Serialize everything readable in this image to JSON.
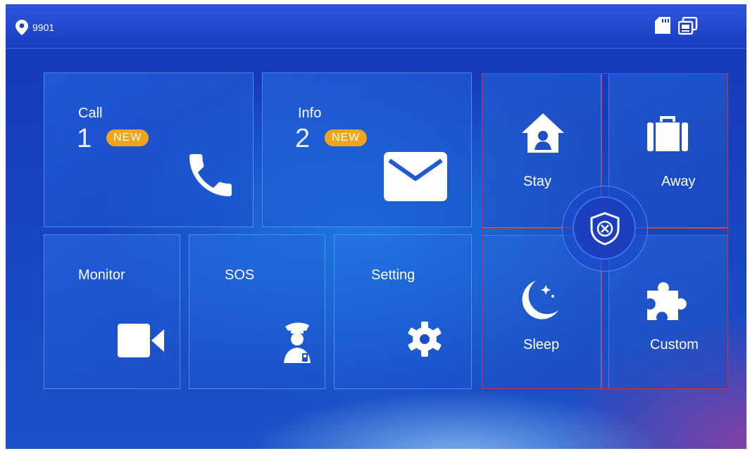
{
  "status_bar": {
    "location_code": "9901",
    "location_icon": "location-pin-icon",
    "right_icons": [
      "sd-card-icon",
      "screens-icon"
    ]
  },
  "tiles": {
    "call": {
      "label": "Call",
      "count": "1",
      "badge": "NEW",
      "icon": "phone-icon"
    },
    "info": {
      "label": "Info",
      "count": "2",
      "badge": "NEW",
      "icon": "envelope-icon"
    },
    "monitor": {
      "label": "Monitor",
      "icon": "video-camera-icon"
    },
    "sos": {
      "label": "SOS",
      "icon": "guard-icon"
    },
    "setting": {
      "label": "Setting",
      "icon": "gear-icon"
    }
  },
  "security": {
    "stay": {
      "label": "Stay",
      "icon": "home-person-icon"
    },
    "away": {
      "label": "Away",
      "icon": "suitcase-icon"
    },
    "sleep": {
      "label": "Sleep",
      "icon": "moon-icon"
    },
    "custom": {
      "label": "Custom",
      "icon": "puzzle-icon"
    },
    "center_icon": "shield-disarm-icon"
  },
  "colors": {
    "accent": "#f0a41a",
    "highlight_border": "#d0303a",
    "background": "#1742c0"
  }
}
